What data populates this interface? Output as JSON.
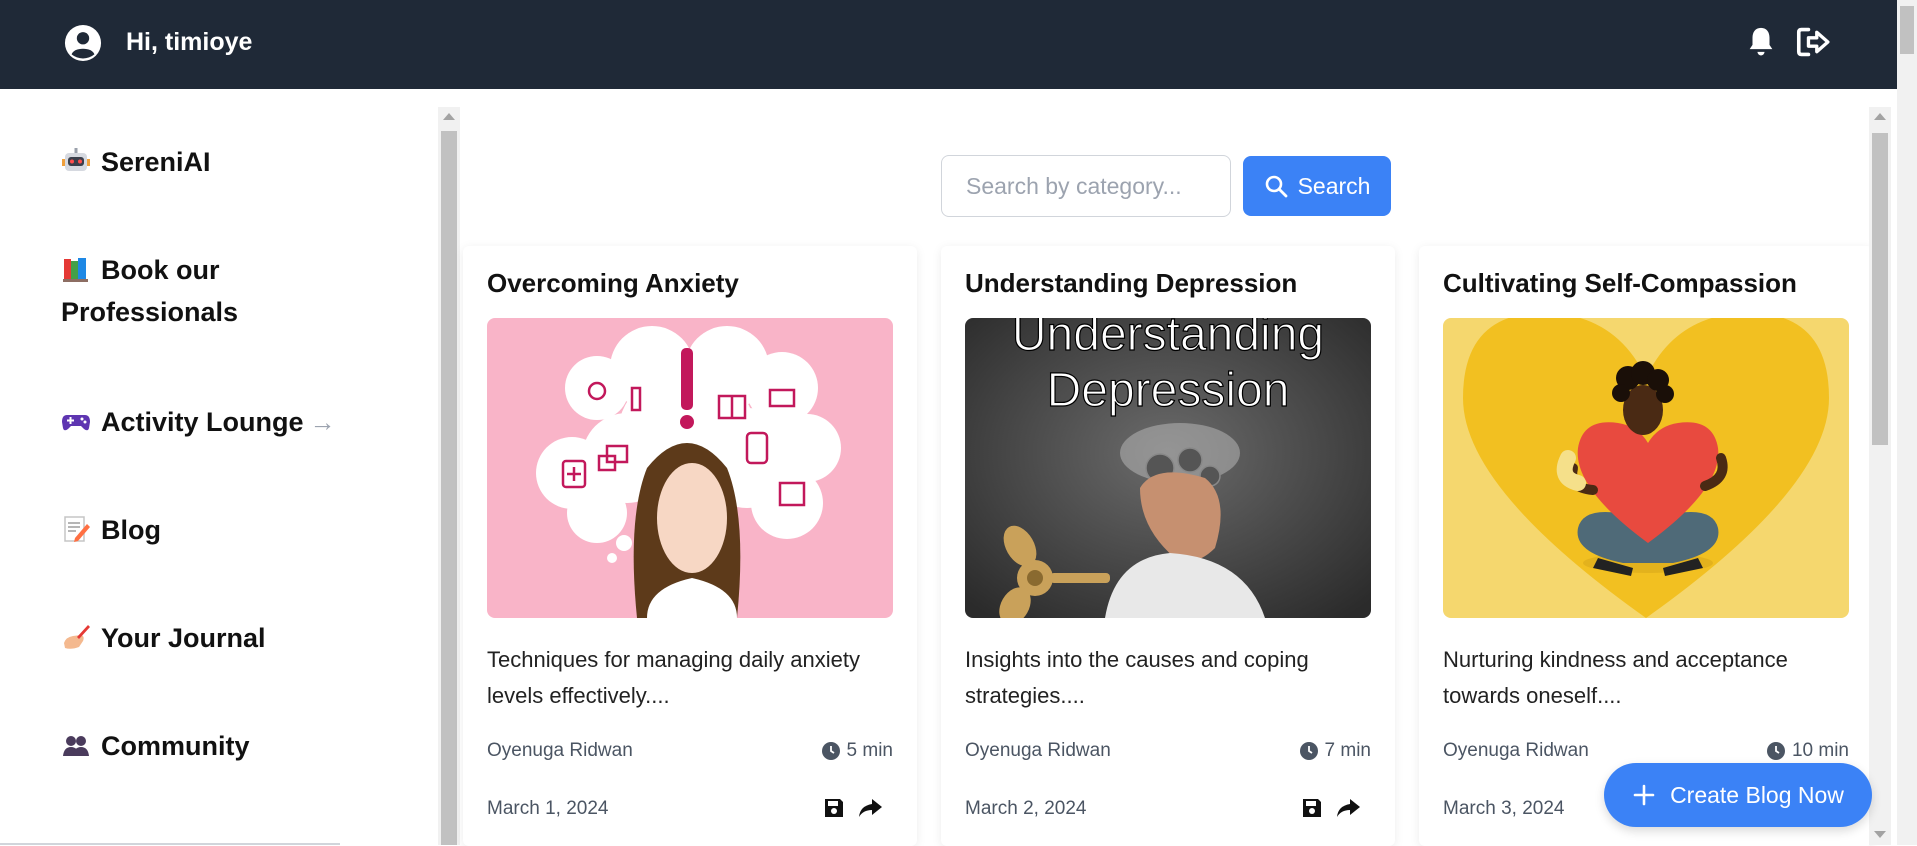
{
  "topbar": {
    "greeting": "Hi, timioye"
  },
  "sidebar": {
    "items": [
      {
        "label": "SereniAI",
        "icon": "robot-icon"
      },
      {
        "label": "Book our",
        "label2": "Professionals",
        "icon": "books-icon"
      },
      {
        "label": "Activity Lounge",
        "icon": "gamepad-icon",
        "arrow": "→"
      },
      {
        "label": "Blog",
        "icon": "memo-icon"
      },
      {
        "label": "Your Journal",
        "icon": "writing-hand-icon"
      },
      {
        "label": "Community",
        "icon": "people-icon"
      }
    ]
  },
  "search": {
    "placeholder": "Search by category...",
    "button_label": "Search"
  },
  "cards": [
    {
      "title": "Overcoming Anxiety",
      "excerpt": "Techniques for managing daily anxiety levels effectively....",
      "author": "Oyenuga Ridwan",
      "time": "5 min",
      "date": "March 1, 2024",
      "image_bg": "#f9b4c8"
    },
    {
      "title": "Understanding Depression",
      "excerpt": "Insights into the causes and coping strategies....",
      "author": "Oyenuga Ridwan",
      "time": "7 min",
      "date": "March 2, 2024",
      "image_bg": "#3b3b3b",
      "image_text_1": "Understanding",
      "image_text_2": "Depression"
    },
    {
      "title": "Cultivating Self-Compassion",
      "excerpt": "Nurturing kindness and acceptance towards oneself....",
      "author": "Oyenuga Ridwan",
      "time": "10 min",
      "date": "March 3, 2024",
      "image_bg": "#f5d76e"
    }
  ],
  "create_button": {
    "label": "Create Blog Now"
  },
  "colors": {
    "topbar": "#1f2937",
    "accent": "#3b82f6"
  }
}
